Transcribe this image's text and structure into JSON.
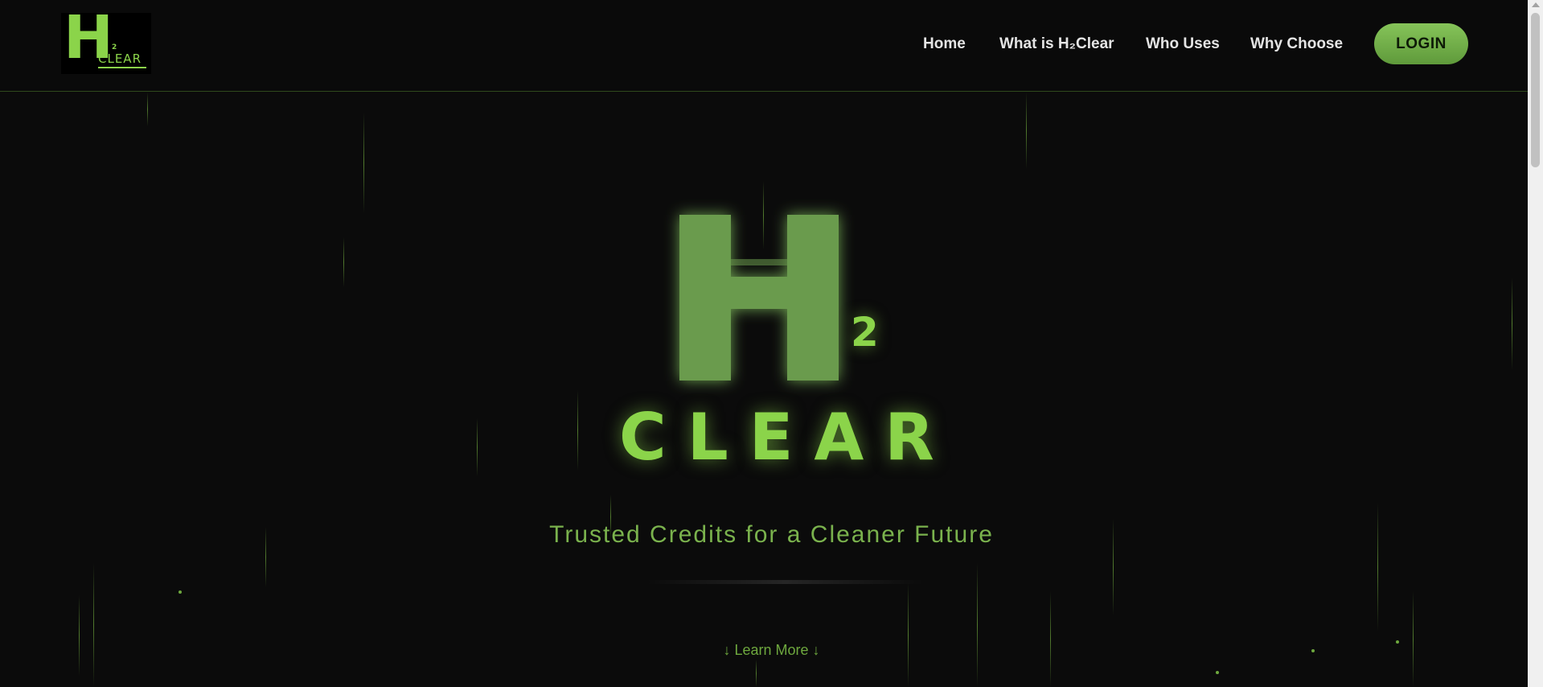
{
  "brand": {
    "logo_letter": "H",
    "logo_sub": "2",
    "logo_word": "CLEAR",
    "accent": "#8bd44a",
    "background": "#0b0b0b"
  },
  "nav": {
    "items": [
      {
        "label": "Home"
      },
      {
        "label": "What is H₂Clear"
      },
      {
        "label": "Who Uses"
      },
      {
        "label": "Why Choose"
      }
    ],
    "login_label": "LOGIN"
  },
  "hero": {
    "letter": "H",
    "subscript": "2",
    "word": "CLEAR",
    "tagline": "Trusted Credits for a Cleaner Future",
    "learn_more": "↓ Learn More ↓"
  }
}
